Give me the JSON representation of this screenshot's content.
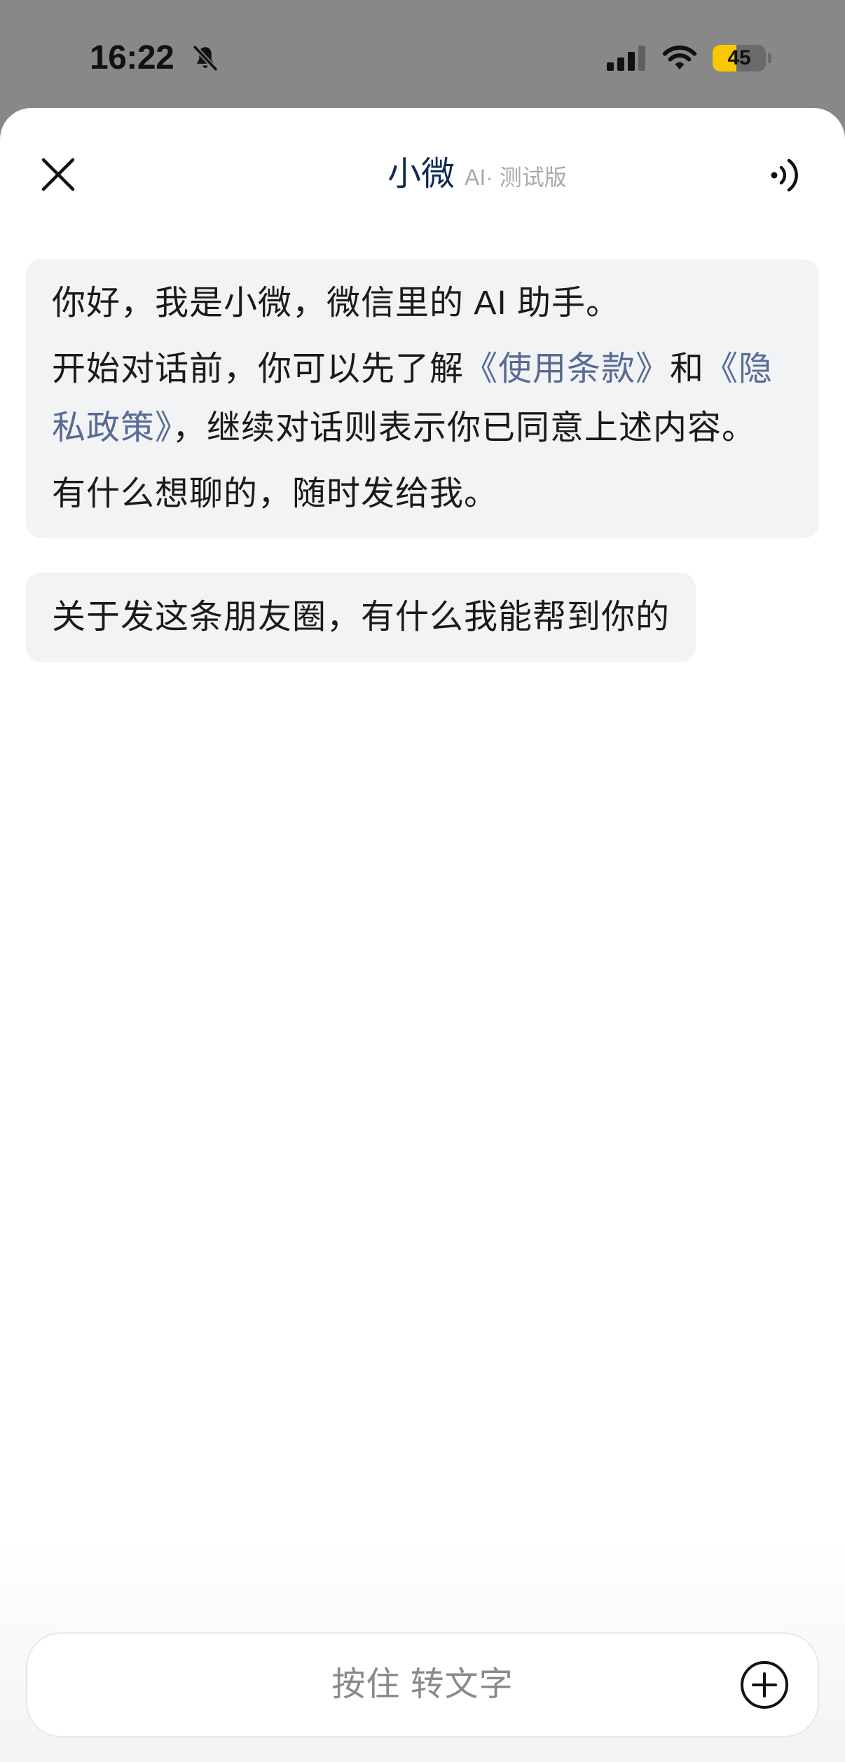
{
  "status_bar": {
    "time": "16:22",
    "battery_text": "45",
    "battery_level": 0.45,
    "icons": {
      "mute": "bell-slash-icon",
      "signal": "signal-icon",
      "wifi": "wifi-icon",
      "battery": "battery-icon"
    }
  },
  "header": {
    "title": "小微",
    "subtitle": "AI· 测试版",
    "close_icon": "close-icon",
    "voice_icon": "speaker-icon"
  },
  "messages": {
    "intro": {
      "greeting": "你好，我是小微，微信里的 AI 助手。",
      "consent_prefix": "开始对话前，你可以先了解",
      "terms_link": "《使用条款》",
      "consent_and": "和",
      "privacy_link": "《隐私政策》",
      "consent_suffix": "，继续对话则表示你已同意上述内容。",
      "invite": "有什么想聊的，随时发给我。"
    },
    "prompt": "关于发这条朋友圈，有什么我能帮到你的"
  },
  "input": {
    "hold_to_talk_label": "按住 转文字",
    "plus_icon": "plus-circle-icon"
  },
  "colors": {
    "status_bar_bg": "#888888",
    "title": "#0f2c52",
    "link": "#576b95",
    "bubble_bg": "#f2f3f4",
    "battery_low_power": "#f8c800"
  }
}
